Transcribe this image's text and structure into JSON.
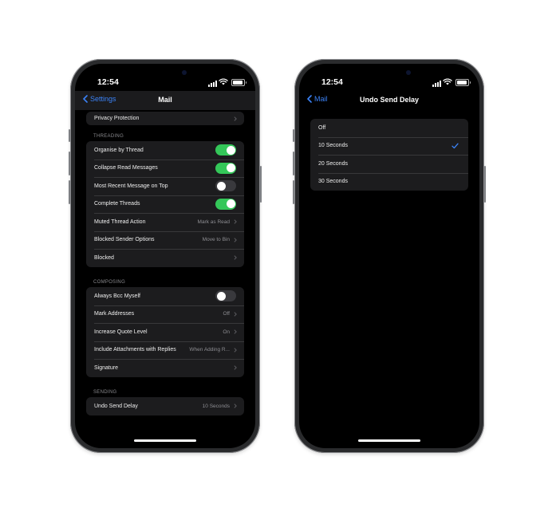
{
  "left_phone": {
    "status_time": "12:54",
    "nav": {
      "back_label": "Settings",
      "title": "Mail"
    },
    "top_row": {
      "label": "Privacy Protection"
    },
    "threading": {
      "header": "THREADING",
      "rows": [
        {
          "label": "Organise by Thread",
          "toggle": true
        },
        {
          "label": "Collapse Read Messages",
          "toggle": true
        },
        {
          "label": "Most Recent Message on Top",
          "toggle": false
        },
        {
          "label": "Complete Threads",
          "toggle": true
        },
        {
          "label": "Muted Thread Action",
          "value": "Mark as Read"
        },
        {
          "label": "Blocked Sender Options",
          "value": "Move to Bin"
        },
        {
          "label": "Blocked",
          "value": ""
        }
      ]
    },
    "composing": {
      "header": "COMPOSING",
      "rows": [
        {
          "label": "Always Bcc Myself",
          "toggle": false
        },
        {
          "label": "Mark Addresses",
          "value": "Off"
        },
        {
          "label": "Increase Quote Level",
          "value": "On"
        },
        {
          "label": "Include Attachments with Replies",
          "value": "When Adding R..."
        },
        {
          "label": "Signature",
          "value": ""
        }
      ]
    },
    "sending": {
      "header": "SENDING",
      "rows": [
        {
          "label": "Undo Send Delay",
          "value": "10 Seconds"
        }
      ]
    }
  },
  "right_phone": {
    "status_time": "12:54",
    "nav": {
      "back_label": "Mail",
      "title": "Undo Send Delay"
    },
    "options": [
      {
        "label": "Off",
        "selected": false
      },
      {
        "label": "10 Seconds",
        "selected": true
      },
      {
        "label": "20 Seconds",
        "selected": false
      },
      {
        "label": "30 Seconds",
        "selected": false
      }
    ]
  },
  "colors": {
    "accent": "#3b82f6",
    "toggle_on": "#34c759",
    "toggle_off": "#39393d",
    "cell_bg": "#1c1c1e",
    "secondary_text": "#8e8e93"
  }
}
